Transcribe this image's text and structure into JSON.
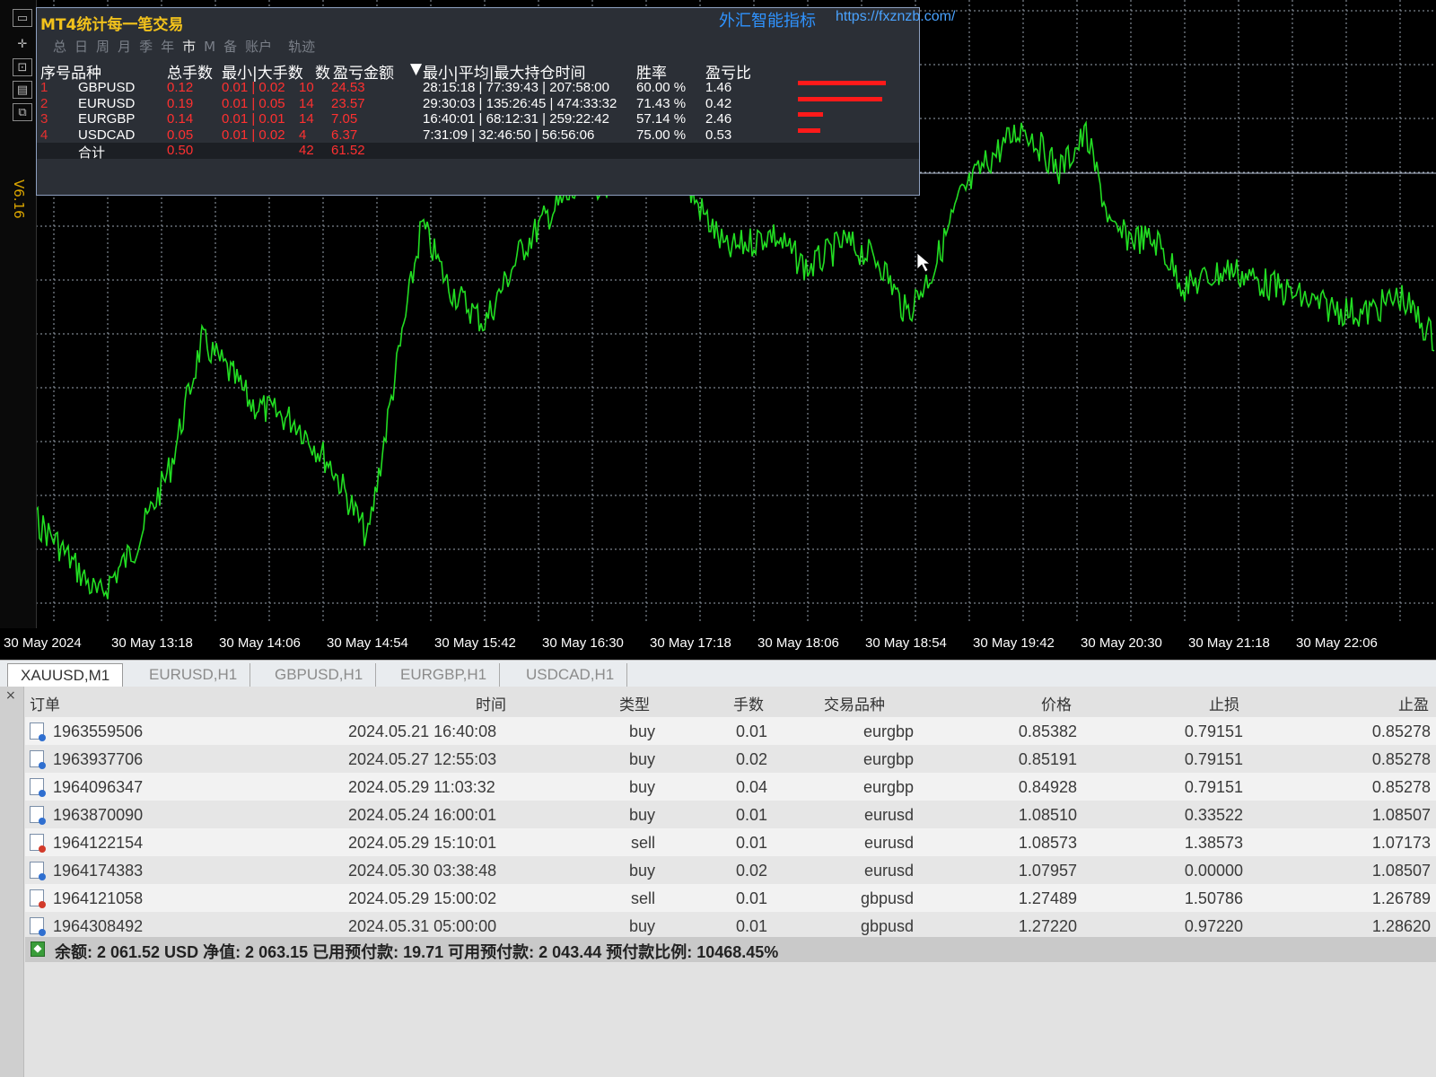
{
  "panel": {
    "title": "MT4统计每一笔交易",
    "link_text": "外汇智能指标",
    "link_url": "https://fxznzb.com/",
    "period_tabs": [
      "总",
      "日",
      "周",
      "月",
      "季",
      "年",
      "市",
      "M",
      "备",
      "账户",
      "",
      "轨迹"
    ],
    "headers": {
      "index_symbol": "序号品种",
      "total_lots": "总手数",
      "min_max_lots": "最小|大手数",
      "count": "数",
      "pl": "盈亏金额",
      "sort_marker": "▼",
      "hold_time": "最小|平均|最大持仓时间",
      "win_rate": "胜率",
      "pl_ratio": "盈亏比"
    },
    "rows": [
      {
        "idx": "1",
        "symbol": "GBPUSD",
        "lots": "0.12",
        "minmax": "0.01 | 0.02",
        "count": "10",
        "pl": "24.53",
        "times": "28:15:18 | 77:39:43 | 207:58:00",
        "win": "60.00 %",
        "ratio": "1.46",
        "bar": 0.98
      },
      {
        "idx": "2",
        "symbol": "EURUSD",
        "lots": "0.19",
        "minmax": "0.01 | 0.05",
        "count": "14",
        "pl": "23.57",
        "times": "29:30:03 | 135:26:45 | 474:33:32",
        "win": "71.43 %",
        "ratio": "0.42",
        "bar": 0.94
      },
      {
        "idx": "3",
        "symbol": "EURGBP",
        "lots": "0.14",
        "minmax": "0.01 | 0.01",
        "count": "14",
        "pl": "7.05",
        "times": "16:40:01 | 68:12:31 | 259:22:42",
        "win": "57.14 %",
        "ratio": "2.46",
        "bar": 0.28
      },
      {
        "idx": "4",
        "symbol": "USDCAD",
        "lots": "0.05",
        "minmax": "0.01 | 0.02",
        "count": "4",
        "pl": "6.37",
        "times": "7:31:09 | 32:46:50 | 56:56:06",
        "win": "75.00 %",
        "ratio": "0.53",
        "bar": 0.25
      }
    ],
    "total": {
      "label": "合计",
      "lots": "0.50",
      "count": "42",
      "pl": "61.52"
    },
    "version": "V6.16"
  },
  "chart": {
    "line_color": "#22dd22",
    "time_ticks": [
      "30 May 2024",
      "30 May 13:18",
      "30 May 14:06",
      "30 May 14:54",
      "30 May 15:42",
      "30 May 16:30",
      "30 May 17:18",
      "30 May 18:06",
      "30 May 18:54",
      "30 May 19:42",
      "30 May 20:30",
      "30 May 21:18",
      "30 May 22:06"
    ]
  },
  "chart_tabs": [
    {
      "label": "XAUUSD,M1",
      "active": true
    },
    {
      "label": "EURUSD,H1",
      "active": false
    },
    {
      "label": "GBPUSD,H1",
      "active": false
    },
    {
      "label": "EURGBP,H1",
      "active": false
    },
    {
      "label": "USDCAD,H1",
      "active": false
    }
  ],
  "terminal": {
    "close_glyph": "×",
    "headers": {
      "order": "订单",
      "time": "时间",
      "type": "类型",
      "lots": "手数",
      "symbol": "交易品种",
      "price": "价格",
      "sl": "止损",
      "tp": "止盈"
    },
    "orders": [
      {
        "order": "1963559506",
        "time": "2024.05.21 16:40:08",
        "type": "buy",
        "lots": "0.01",
        "symbol": "eurgbp",
        "price": "0.85382",
        "sl": "0.79151",
        "tp": "0.85278"
      },
      {
        "order": "1963937706",
        "time": "2024.05.27 12:55:03",
        "type": "buy",
        "lots": "0.02",
        "symbol": "eurgbp",
        "price": "0.85191",
        "sl": "0.79151",
        "tp": "0.85278"
      },
      {
        "order": "1964096347",
        "time": "2024.05.29 11:03:32",
        "type": "buy",
        "lots": "0.04",
        "symbol": "eurgbp",
        "price": "0.84928",
        "sl": "0.79151",
        "tp": "0.85278"
      },
      {
        "order": "1963870090",
        "time": "2024.05.24 16:00:01",
        "type": "buy",
        "lots": "0.01",
        "symbol": "eurusd",
        "price": "1.08510",
        "sl": "0.33522",
        "tp": "1.08507"
      },
      {
        "order": "1964122154",
        "time": "2024.05.29 15:10:01",
        "type": "sell",
        "lots": "0.01",
        "symbol": "eurusd",
        "price": "1.08573",
        "sl": "1.38573",
        "tp": "1.07173"
      },
      {
        "order": "1964174383",
        "time": "2024.05.30 03:38:48",
        "type": "buy",
        "lots": "0.02",
        "symbol": "eurusd",
        "price": "1.07957",
        "sl": "0.00000",
        "tp": "1.08507"
      },
      {
        "order": "1964121058",
        "time": "2024.05.29 15:00:02",
        "type": "sell",
        "lots": "0.01",
        "symbol": "gbpusd",
        "price": "1.27489",
        "sl": "1.50786",
        "tp": "1.26789"
      },
      {
        "order": "1964308492",
        "time": "2024.05.31 05:00:00",
        "type": "buy",
        "lots": "0.01",
        "symbol": "gbpusd",
        "price": "1.27220",
        "sl": "0.97220",
        "tp": "1.28620"
      }
    ],
    "summary": "余额: 2 061.52 USD  净值: 2 063.15  已用预付款: 19.71  可用预付款: 2 043.44  预付款比例: 10468.45%"
  }
}
